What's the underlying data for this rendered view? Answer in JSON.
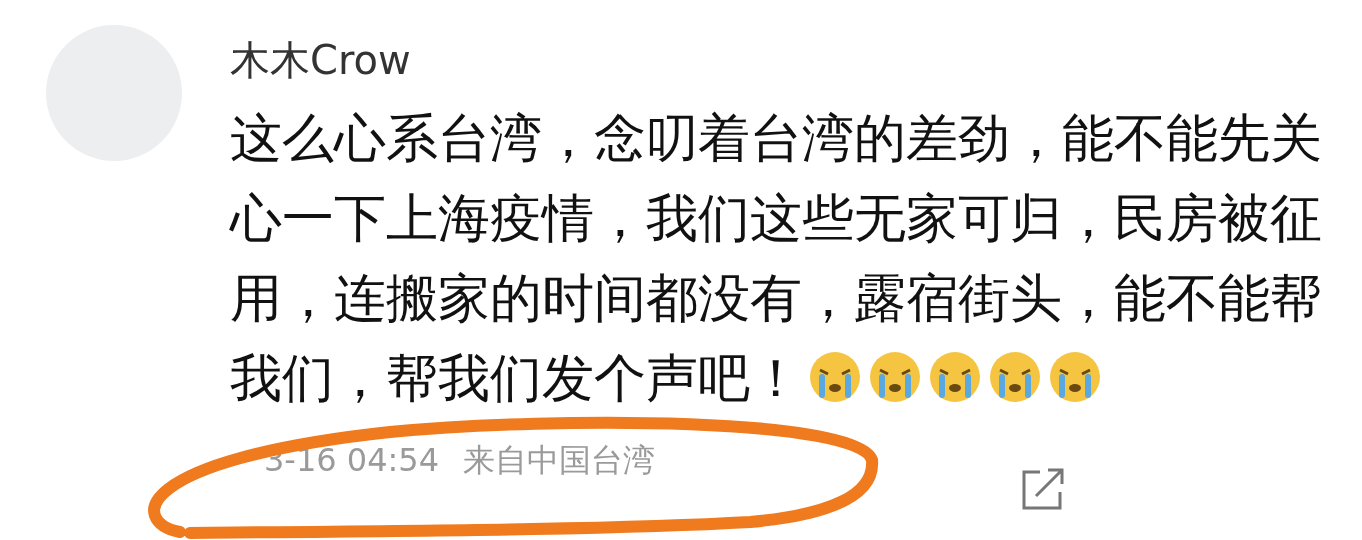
{
  "comment": {
    "username": "木木Crow",
    "lines": [
      "这么心系台湾，念叨着台湾的差劲，能不能先关",
      "心一下上海疫情，我们这些无家可归，民房被征",
      "用，连搬家的时间都没有，露宿街头，能不能帮",
      "我们，帮我们发个声吧！"
    ],
    "emojis": [
      {
        "kind": "crying"
      },
      {
        "kind": "crying"
      },
      {
        "kind": "crying"
      },
      {
        "kind": "crying"
      },
      {
        "kind": "crying"
      }
    ],
    "time": "3-16 04:54",
    "location": "来自中国台湾"
  }
}
